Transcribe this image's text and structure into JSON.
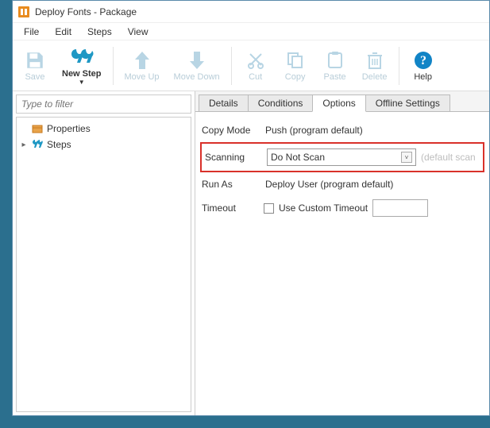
{
  "title": "Deploy Fonts - Package",
  "menus": [
    "File",
    "Edit",
    "Steps",
    "View"
  ],
  "toolbar": {
    "save": "Save",
    "newstep": "New Step",
    "moveup": "Move Up",
    "movedown": "Move Down",
    "cut": "Cut",
    "copy": "Copy",
    "paste": "Paste",
    "delete": "Delete",
    "help": "Help"
  },
  "filter_placeholder": "Type to filter",
  "tree": {
    "properties": "Properties",
    "steps": "Steps"
  },
  "tabs": [
    "Details",
    "Conditions",
    "Options",
    "Offline Settings"
  ],
  "active_tab": "Options",
  "form": {
    "copy_mode_label": "Copy Mode",
    "copy_mode_value": "Push (program default)",
    "scanning_label": "Scanning",
    "scanning_value": "Do Not Scan",
    "scanning_hint": "(default scan",
    "run_as_label": "Run As",
    "run_as_value": "Deploy User (program default)",
    "timeout_label": "Timeout",
    "timeout_check_label": "Use Custom Timeout"
  }
}
